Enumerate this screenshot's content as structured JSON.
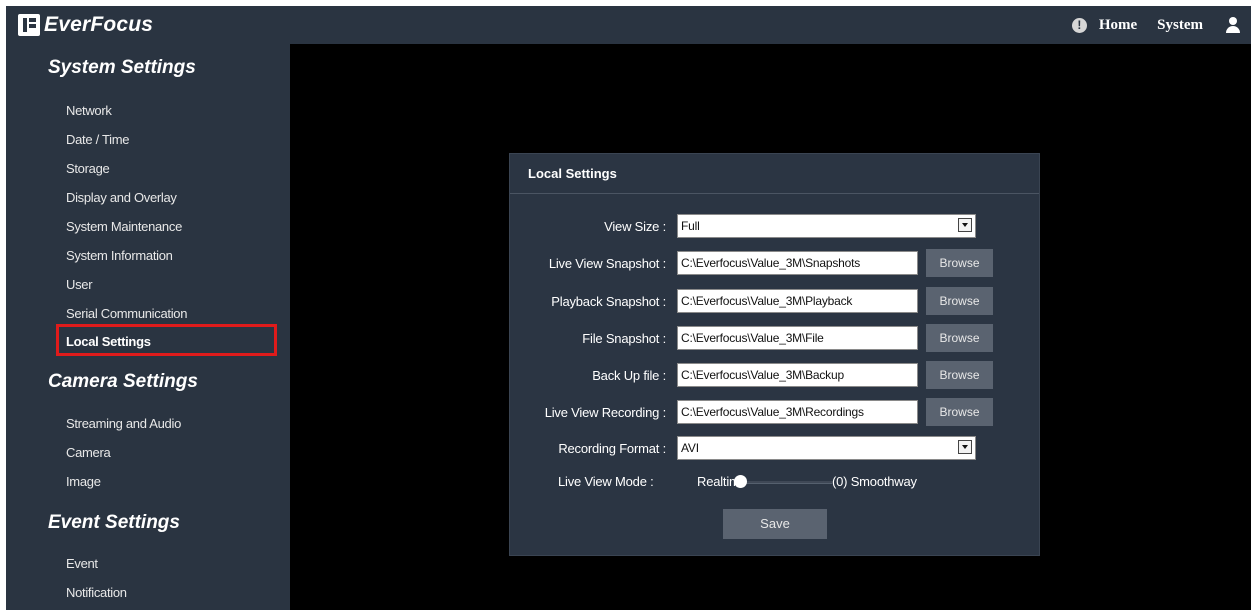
{
  "brand": {
    "name": "EverFocus"
  },
  "topnav": {
    "home": "Home",
    "system": "System"
  },
  "sidebar": {
    "sections": [
      {
        "title": "System Settings",
        "items": [
          "Network",
          "Date / Time",
          "Storage",
          "Display and Overlay",
          "System Maintenance",
          "System Information",
          "User",
          "Serial Communication",
          "Local Settings"
        ]
      },
      {
        "title": "Camera Settings",
        "items": [
          "Streaming and Audio",
          "Camera",
          "Image"
        ]
      },
      {
        "title": "Event Settings",
        "items": [
          "Event",
          "Notification"
        ]
      }
    ],
    "active_item": "Local Settings"
  },
  "panel": {
    "title": "Local Settings",
    "view_size": {
      "label": "View Size :",
      "value": "Full"
    },
    "live_view_snapshot": {
      "label": "Live View Snapshot :",
      "value": "C:\\Everfocus\\Value_3M\\Snapshots",
      "button": "Browse"
    },
    "playback_snapshot": {
      "label": "Playback Snapshot :",
      "value": "C:\\Everfocus\\Value_3M\\Playback",
      "button": "Browse"
    },
    "file_snapshot": {
      "label": "File Snapshot :",
      "value": "C:\\Everfocus\\Value_3M\\File",
      "button": "Browse"
    },
    "back_up_file": {
      "label": "Back Up file :",
      "value": "C:\\Everfocus\\Value_3M\\Backup",
      "button": "Browse"
    },
    "live_view_recording": {
      "label": "Live View Recording :",
      "value": "C:\\Everfocus\\Value_3M\\Recordings",
      "button": "Browse"
    },
    "recording_format": {
      "label": "Recording Format :",
      "value": "AVI"
    },
    "live_view_mode": {
      "label": "Live View Mode :",
      "left_label": "Realtime",
      "value_text": "(0) Smoothway",
      "value": 0
    },
    "save": "Save"
  },
  "colors": {
    "bar_bg": "#2a3441",
    "panel_bg": "#2b3543",
    "button_bg": "#5a6370",
    "highlight": "#e01b1b",
    "content_bg": "#000000"
  },
  "icons": {
    "info": "info-circle-icon",
    "user": "user-icon",
    "select": "chevron-down-icon"
  }
}
